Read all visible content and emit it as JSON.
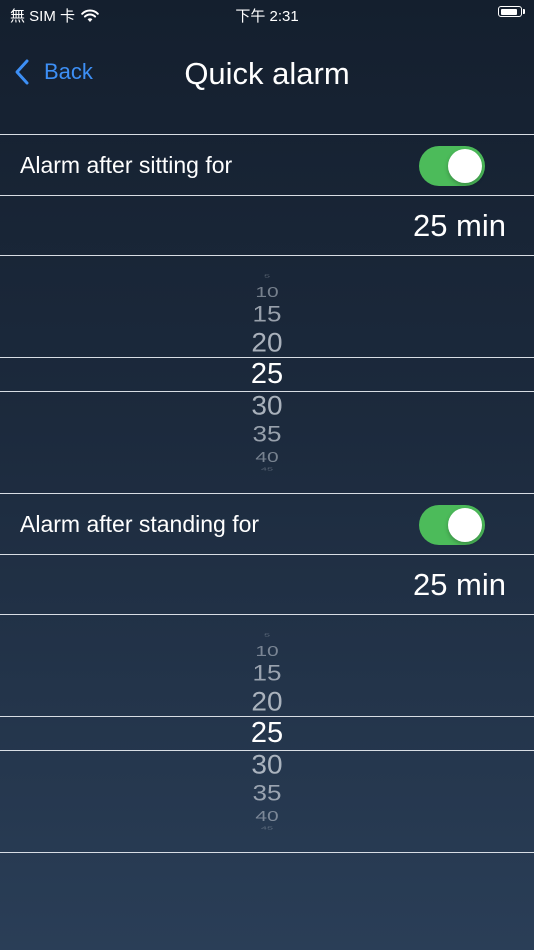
{
  "status_bar": {
    "carrier": "無 SIM 卡",
    "time": "下午 2:31",
    "battery_level": 0.85
  },
  "nav": {
    "back_label": "Back",
    "title": "Quick alarm"
  },
  "sections": [
    {
      "label": "Alarm after sitting for",
      "toggle_on": true,
      "value_display": "25 min",
      "picker_items": [
        "5",
        "10",
        "15",
        "20",
        "25",
        "30",
        "35",
        "40",
        "45"
      ],
      "selected": "25"
    },
    {
      "label": "Alarm after standing for",
      "toggle_on": true,
      "value_display": "25 min",
      "picker_items": [
        "5",
        "10",
        "15",
        "20",
        "25",
        "30",
        "35",
        "40",
        "45"
      ],
      "selected": "25"
    }
  ],
  "colors": {
    "accent": "#3d8ff5",
    "toggle_on": "#4cbb5a",
    "background_top": "#141f2e",
    "background_bottom": "#2a3e57"
  }
}
